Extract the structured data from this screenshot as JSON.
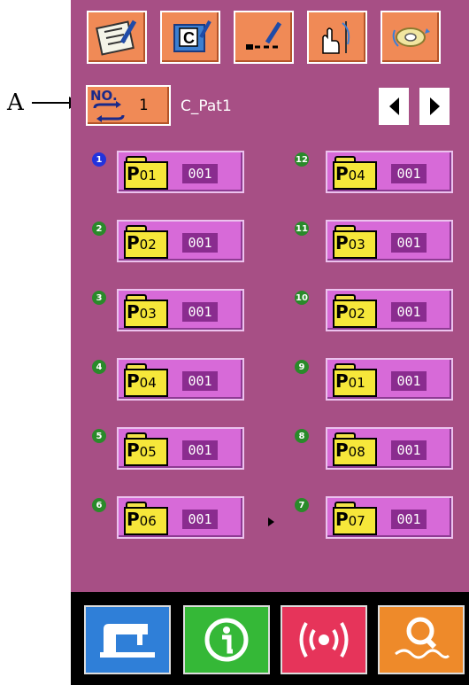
{
  "callout": {
    "label": "A"
  },
  "toolbar": {
    "buttons": [
      {
        "icon": "checklist-pencil-icon"
      },
      {
        "icon": "c-cassette-icon"
      },
      {
        "icon": "dashed-line-pencil-icon"
      },
      {
        "icon": "hand-needle-icon"
      },
      {
        "icon": "bobbin-winder-icon"
      }
    ]
  },
  "pattern_no": {
    "label": "NO.",
    "value": "1",
    "name": "C_Pat1"
  },
  "patterns_left": [
    {
      "index": "1",
      "label": "P",
      "num": "01",
      "count": "001",
      "index_color": "blue"
    },
    {
      "index": "2",
      "label": "P",
      "num": "02",
      "count": "001",
      "index_color": "green"
    },
    {
      "index": "3",
      "label": "P",
      "num": "03",
      "count": "001",
      "index_color": "green"
    },
    {
      "index": "4",
      "label": "P",
      "num": "04",
      "count": "001",
      "index_color": "green"
    },
    {
      "index": "5",
      "label": "P",
      "num": "05",
      "count": "001",
      "index_color": "green"
    },
    {
      "index": "6",
      "label": "P",
      "num": "06",
      "count": "001",
      "index_color": "green"
    }
  ],
  "patterns_right": [
    {
      "index": "12",
      "label": "P",
      "num": "04",
      "count": "001",
      "index_color": "green"
    },
    {
      "index": "11",
      "label": "P",
      "num": "03",
      "count": "001",
      "index_color": "green"
    },
    {
      "index": "10",
      "label": "P",
      "num": "02",
      "count": "001",
      "index_color": "green"
    },
    {
      "index": "9",
      "label": "P",
      "num": "01",
      "count": "001",
      "index_color": "green"
    },
    {
      "index": "8",
      "label": "P",
      "num": "08",
      "count": "001",
      "index_color": "green"
    },
    {
      "index": "7",
      "label": "P",
      "num": "07",
      "count": "001",
      "index_color": "green"
    }
  ],
  "bottom": [
    {
      "icon": "sewing-machine-icon",
      "color": "#2f7fd8"
    },
    {
      "icon": "info-icon",
      "color": "#35b837"
    },
    {
      "icon": "signal-icon",
      "color": "#e6345a"
    },
    {
      "icon": "search-icon",
      "color": "#ee8a2a"
    }
  ]
}
